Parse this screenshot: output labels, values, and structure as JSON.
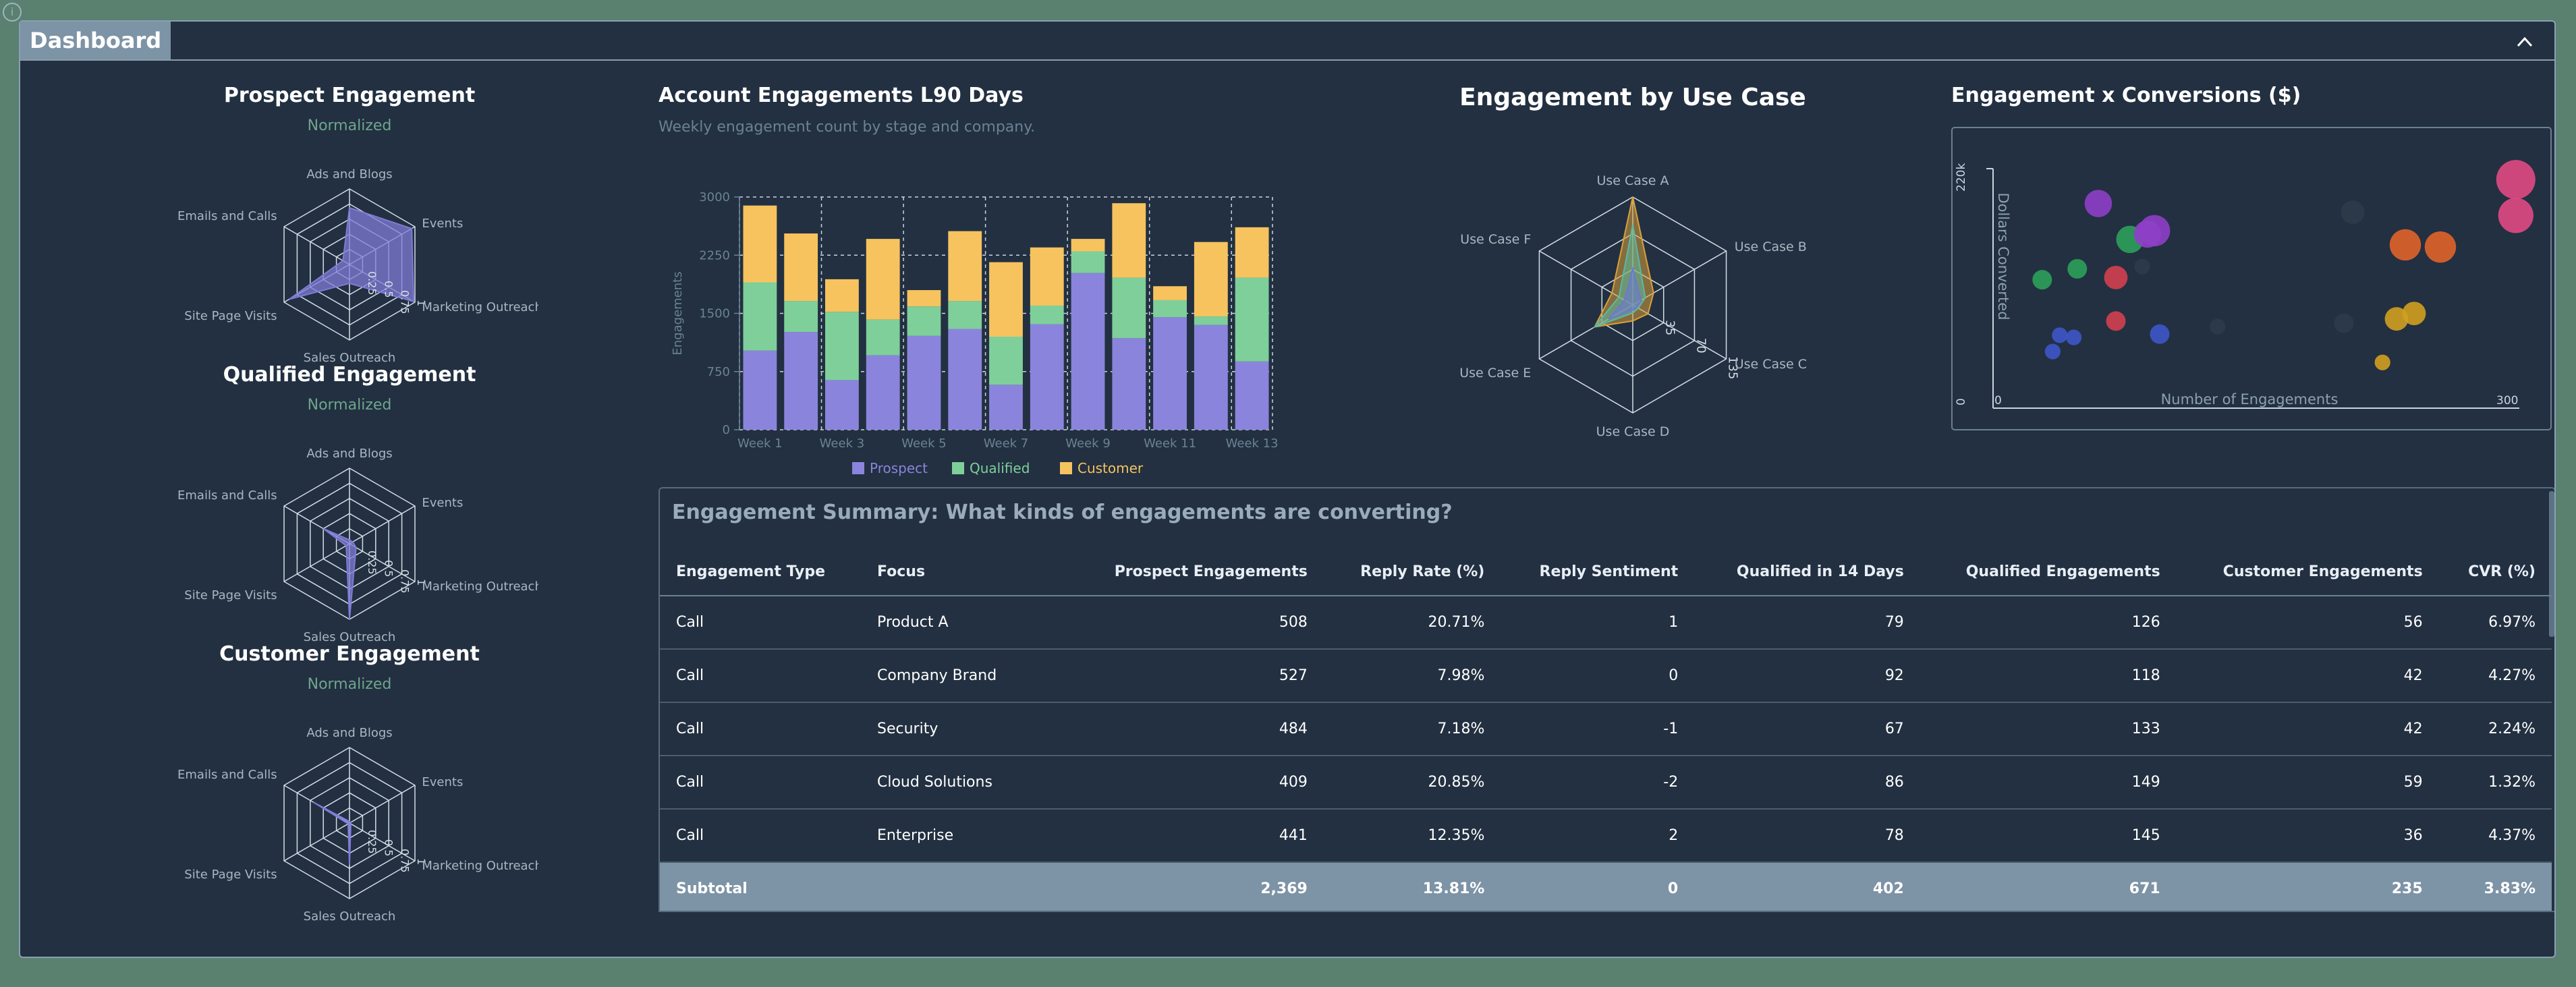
{
  "dashboard": {
    "title": "Dashboard"
  },
  "radars": [
    {
      "title": "Prospect Engagement",
      "subtitle": "Normalized",
      "axes": [
        "Ads and Blogs",
        "Events",
        "Marketing Outreach",
        "Sales Outreach",
        "Site Page Visits",
        "Emails and Calls"
      ],
      "ticks": [
        "0.25",
        "0.5",
        "0.75",
        "1"
      ],
      "values": [
        0.75,
        0.95,
        0.98,
        0.25,
        0.92,
        0.1
      ],
      "color": "#7f7bd6"
    },
    {
      "title": "Qualified Engagement",
      "subtitle": "Normalized",
      "axes": [
        "Ads and Blogs",
        "Events",
        "Marketing Outreach",
        "Sales Outreach",
        "Site Page Visits",
        "Emails and Calls"
      ],
      "ticks": [
        "0.25",
        "0.5",
        "0.75",
        "1"
      ],
      "values": [
        0.05,
        0.05,
        0.1,
        1.0,
        0.05,
        0.4
      ],
      "color": "#7f7bd6"
    },
    {
      "title": "Customer Engagement",
      "subtitle": "Normalized",
      "axes": [
        "Ads and Blogs",
        "Events",
        "Marketing Outreach",
        "Sales Outreach",
        "Site Page Visits",
        "Emails and Calls"
      ],
      "ticks": [
        "0.25",
        "0.5",
        "0.75",
        "1"
      ],
      "values": [
        0.02,
        0.02,
        0.02,
        0.55,
        0.02,
        0.55
      ],
      "color": "#7f7bd6"
    }
  ],
  "bar_chart": {
    "title": "Account Engagements L90 Days",
    "subtitle": "Weekly engagement count by stage and company.",
    "chart_data": {
      "type": "bar",
      "stacked": true,
      "title": "Account Engagements L90 Days",
      "ylabel": "Engagements",
      "ylim": [
        0,
        3000
      ],
      "yticks": [
        0,
        750,
        1500,
        2250,
        3000
      ],
      "categories": [
        "Week 1",
        "Week 2",
        "Week 3",
        "Week 4",
        "Week 5",
        "Week 6",
        "Week 7",
        "Week 8",
        "Week 9",
        "Week 10",
        "Week 11",
        "Week 12",
        "Week 13"
      ],
      "xtick_labels": [
        "Week 1",
        "Week 3",
        "Week 5",
        "Week 7",
        "Week 9",
        "Week 11",
        "Week 13"
      ],
      "series": [
        {
          "name": "Prospect",
          "color": "#8b84dc",
          "values": [
            1020,
            1260,
            640,
            960,
            1210,
            1300,
            580,
            1360,
            2020,
            1180,
            1450,
            1350,
            880
          ]
        },
        {
          "name": "Qualified",
          "color": "#7fcf9b",
          "values": [
            880,
            400,
            880,
            460,
            380,
            360,
            620,
            240,
            280,
            780,
            220,
            110,
            1080
          ]
        },
        {
          "name": "Customer",
          "color": "#f6c35f",
          "values": [
            990,
            870,
            420,
            1040,
            210,
            900,
            960,
            750,
            160,
            960,
            180,
            960,
            650
          ]
        }
      ],
      "legend": "bottom",
      "grid": true
    }
  },
  "radar_use_case": {
    "title": "Engagement by Use Case",
    "chart_data": {
      "type": "radar",
      "axes": [
        "Use Case A",
        "Use Case B",
        "Use Case C",
        "Use Case D",
        "Use Case E",
        "Use Case F"
      ],
      "ticks": [
        "35",
        "70",
        "135"
      ],
      "rmax": 135,
      "series": [
        {
          "color": "#d9a13a",
          "values": [
            135,
            30,
            22,
            20,
            55,
            30
          ]
        },
        {
          "color": "#5db8a0",
          "values": [
            100,
            18,
            8,
            10,
            55,
            20
          ]
        },
        {
          "color": "#6a79d6",
          "values": [
            45,
            12,
            6,
            6,
            35,
            12
          ]
        }
      ]
    }
  },
  "bubble_chart": {
    "title": "Engagement x Conversions ($)",
    "chart_data": {
      "type": "scatter",
      "xlabel": "Number of Engagements",
      "ylabel": "Dollars Converted",
      "xlim": [
        0,
        300
      ],
      "ylim": [
        0,
        220000
      ],
      "xtick_labels": [
        "0",
        "300"
      ],
      "ytick_labels": [
        "0",
        "220k"
      ],
      "points": [
        {
          "x": 200,
          "y": 78000,
          "size": 10,
          "color": "#2d3b4a"
        },
        {
          "x": 205,
          "y": 180000,
          "size": 12,
          "color": "#2d3b4a"
        },
        {
          "x": 60,
          "y": 188000,
          "size": 14,
          "color": "#8e3fc8"
        },
        {
          "x": 78,
          "y": 155000,
          "size": 14,
          "color": "#2ca05a"
        },
        {
          "x": 88,
          "y": 160000,
          "size": 14,
          "color": "#8e3fc8"
        },
        {
          "x": 92,
          "y": 163000,
          "size": 16,
          "color": "#8e3fc8"
        },
        {
          "x": 85,
          "y": 130000,
          "size": 8,
          "color": "#2d3b4a"
        },
        {
          "x": 48,
          "y": 128000,
          "size": 10,
          "color": "#2ca05a"
        },
        {
          "x": 28,
          "y": 118000,
          "size": 10,
          "color": "#2ca05a"
        },
        {
          "x": 70,
          "y": 120000,
          "size": 12,
          "color": "#d2404f"
        },
        {
          "x": 70,
          "y": 80000,
          "size": 10,
          "color": "#d2404f"
        },
        {
          "x": 46,
          "y": 65000,
          "size": 8,
          "color": "#3e56c8"
        },
        {
          "x": 34,
          "y": 52000,
          "size": 8,
          "color": "#3e56c8"
        },
        {
          "x": 38,
          "y": 67000,
          "size": 8,
          "color": "#3e56c8"
        },
        {
          "x": 95,
          "y": 68000,
          "size": 10,
          "color": "#3e56c8"
        },
        {
          "x": 128,
          "y": 75000,
          "size": 8,
          "color": "#2d3b4a"
        },
        {
          "x": 235,
          "y": 150000,
          "size": 16,
          "color": "#e0642a"
        },
        {
          "x": 255,
          "y": 148000,
          "size": 16,
          "color": "#e0642a"
        },
        {
          "x": 230,
          "y": 82000,
          "size": 12,
          "color": "#d0a020"
        },
        {
          "x": 240,
          "y": 87000,
          "size": 12,
          "color": "#d0a020"
        },
        {
          "x": 222,
          "y": 42000,
          "size": 8,
          "color": "#d0a020"
        },
        {
          "x": 298,
          "y": 210000,
          "size": 20,
          "color": "#e04a84"
        },
        {
          "x": 298,
          "y": 177000,
          "size": 18,
          "color": "#e04a84"
        }
      ]
    }
  },
  "summary": {
    "title": "Engagement Summary: What kinds of engagements are converting?",
    "columns": [
      "Engagement Type",
      "Focus",
      "Prospect Engagements",
      "Reply Rate (%)",
      "Reply Sentiment",
      "Qualified in 14 Days",
      "Qualified Engagements",
      "Customer Engagements",
      "CVR (%)"
    ],
    "rows": [
      [
        "Call",
        "Product A",
        "508",
        "20.71%",
        "1",
        "79",
        "126",
        "56",
        "6.97%"
      ],
      [
        "Call",
        "Company Brand",
        "527",
        "7.98%",
        "0",
        "92",
        "118",
        "42",
        "4.27%"
      ],
      [
        "Call",
        "Security",
        "484",
        "7.18%",
        "-1",
        "67",
        "133",
        "42",
        "2.24%"
      ],
      [
        "Call",
        "Cloud Solutions",
        "409",
        "20.85%",
        "-2",
        "86",
        "149",
        "59",
        "1.32%"
      ],
      [
        "Call",
        "Enterprise",
        "441",
        "12.35%",
        "2",
        "78",
        "145",
        "36",
        "4.37%"
      ]
    ],
    "subtotal": [
      "Subtotal",
      "",
      "2,369",
      "13.81%",
      "0",
      "402",
      "671",
      "235",
      "3.83%"
    ]
  }
}
